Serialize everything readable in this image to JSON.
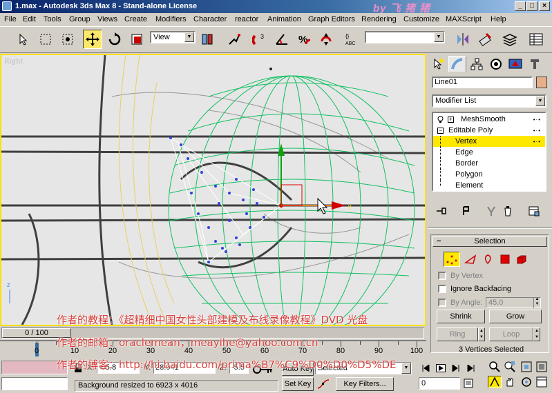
{
  "window": {
    "title": "1.max - Autodesk 3ds Max 8  - Stand-alone License",
    "watermark": "by 飞 猪 猪",
    "minimize": "_",
    "maximize": "□",
    "close": "×"
  },
  "menu": [
    "File",
    "Edit",
    "Tools",
    "Group",
    "Views",
    "Create",
    "Modifiers",
    "Character",
    "reactor",
    "Animation",
    "Graph Editors",
    "Rendering",
    "Customize",
    "MAXScript",
    "Help"
  ],
  "toolbar": {
    "ref_coord": "View",
    "named_selection": "",
    "icons": [
      "select-icon",
      "select-region-icon",
      "window-crossing-icon",
      "move-icon",
      "rotate-icon",
      "scale-icon",
      "pivot-icon",
      "manipulate-icon",
      "snap-3d-icon",
      "angle-snap-icon",
      "percent-snap-icon",
      "spinner-snap-icon",
      "edit-named-sel-icon",
      "mirror-icon",
      "align-icon",
      "layer-icon",
      "curve-editor-icon"
    ]
  },
  "viewport": {
    "label": "Right",
    "x_axis_label": "y",
    "corner_axis_label": "z"
  },
  "command_panel": {
    "tabs": [
      "create-tab",
      "modify-tab",
      "hierarchy-tab",
      "motion-tab",
      "display-tab",
      "utilities-tab"
    ],
    "object_name": "Line01",
    "object_color": "#e8b08a",
    "modifier_list": "Modifier List",
    "stack": [
      {
        "label": "MeshSmooth",
        "level": 0,
        "expand": "+"
      },
      {
        "label": "Editable Poly",
        "level": 0,
        "expand": "−"
      },
      {
        "label": "Vertex",
        "level": 1,
        "selected": true
      },
      {
        "label": "Edge",
        "level": 1
      },
      {
        "label": "Border",
        "level": 1
      },
      {
        "label": "Polygon",
        "level": 1
      },
      {
        "label": "Element",
        "level": 1
      }
    ],
    "selection": {
      "title": "Selection",
      "by_vertex": "By Vertex",
      "ignore_backfacing": "Ignore Backfacing",
      "by_angle": "By Angle:",
      "angle_value": "45.0",
      "shrink": "Shrink",
      "grow": "Grow",
      "ring": "Ring",
      "loop": "Loop",
      "status": "3 Vertices Selected"
    }
  },
  "timeline": {
    "frame": "0 / 100",
    "ticks": [
      "0",
      "10",
      "20",
      "30",
      "40",
      "50",
      "60",
      "70",
      "80",
      "90",
      "100"
    ]
  },
  "status": {
    "x_label": "X:",
    "x_value": "-65.8",
    "y_label": "Y:",
    "y_value": "28.041",
    "z_label": "Z:",
    "z_value": "-5.5",
    "prompt": "Background resized to 6923 x 4016",
    "auto_key": "Auto Key",
    "key_mode": "Selected",
    "set_key": "Set Key",
    "key_filters": "Key Filters...",
    "current_frame": "0"
  },
  "overlay": {
    "line1": "作者的教程：《超精细中国女性头部建模及布线录像教程》DVD 光盘",
    "line2": "作者的邮箱：oraclemean，meayihe@yahoo.com.cn",
    "line3": "作者的博客：http://hi.baidu.com/prima%B7%C9%D0%D0%D5%DE"
  }
}
